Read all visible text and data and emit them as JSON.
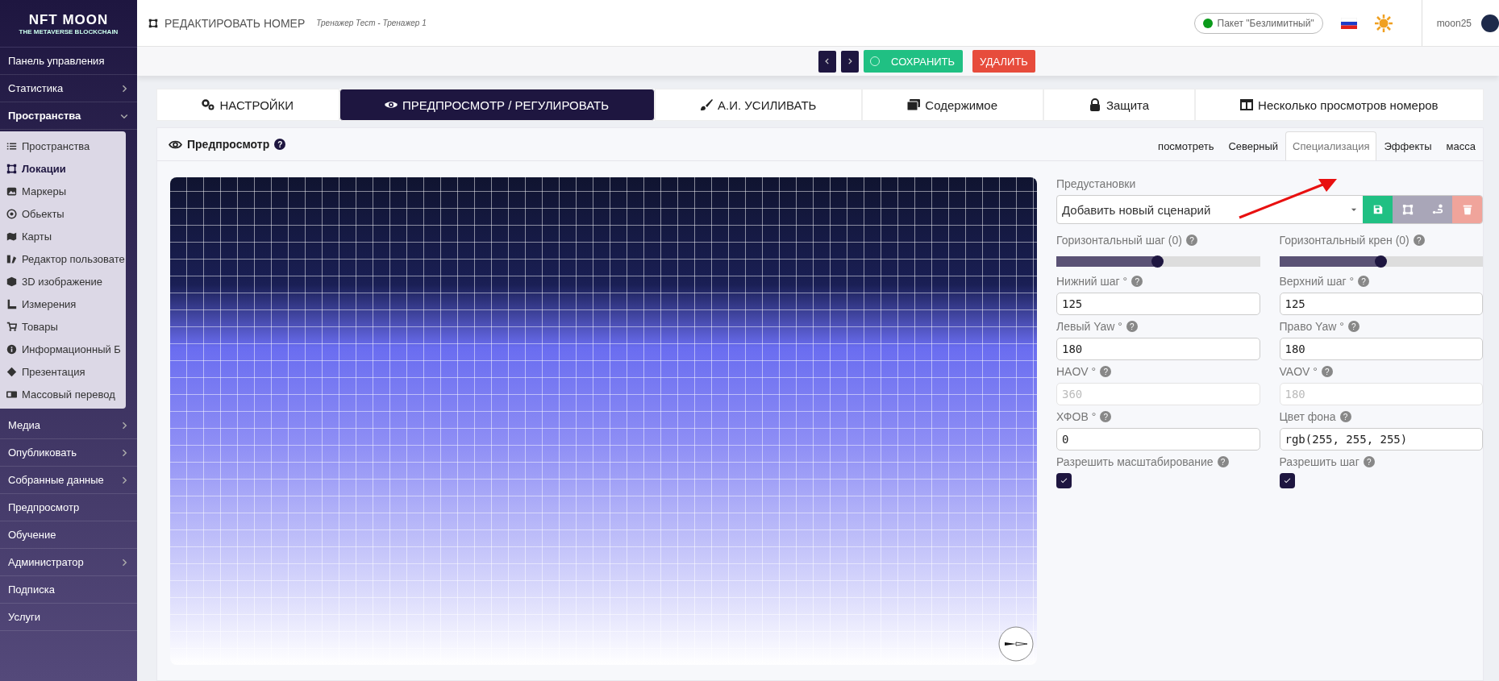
{
  "sidebar": {
    "logo": {
      "title": "NFT MOON",
      "subtitle": "THE METAVERSE BLOCKCHAIN"
    },
    "items": [
      {
        "label": "Панель управления",
        "kind": "link"
      },
      {
        "label": "Статистика",
        "kind": "group",
        "expanded": false
      },
      {
        "label": "Пространства",
        "kind": "group",
        "expanded": true,
        "children": [
          {
            "label": "Пространства",
            "selected": false
          },
          {
            "label": "Локации",
            "selected": true
          },
          {
            "label": "Маркеры",
            "selected": false
          },
          {
            "label": "Обьекты",
            "selected": false
          },
          {
            "label": "Карты",
            "selected": false
          },
          {
            "label": "Редактор пользовате",
            "selected": false
          },
          {
            "label": "3D изображение",
            "selected": false
          },
          {
            "label": "Измерения",
            "selected": false
          },
          {
            "label": "Товары",
            "selected": false
          },
          {
            "label": "Информационный Б",
            "selected": false
          },
          {
            "label": "Презентация",
            "selected": false
          },
          {
            "label": "Массовый перевод",
            "selected": false
          }
        ]
      },
      {
        "label": "Медиа",
        "kind": "group",
        "expanded": false
      },
      {
        "label": "Опубликовать",
        "kind": "group",
        "expanded": false
      },
      {
        "label": "Собранные данные",
        "kind": "group",
        "expanded": false
      },
      {
        "label": "Предпросмотр",
        "kind": "link"
      },
      {
        "label": "Обучение",
        "kind": "link"
      },
      {
        "label": "Администратор",
        "kind": "group",
        "expanded": false
      },
      {
        "label": "Подписка",
        "kind": "link"
      },
      {
        "label": "Услуги",
        "kind": "link"
      }
    ]
  },
  "header": {
    "title": "РЕДАКТИРОВАТЬ НОМЕР",
    "subtitle": "Тренажер Тест - Тренажер 1",
    "package": "Пакет \"Безлимитный\"",
    "user": "moon25"
  },
  "toolbar": {
    "save": "СОХРАНИТЬ",
    "delete": "УДАЛИТЬ"
  },
  "tabs": [
    {
      "label": "НАСТРОЙКИ",
      "selected": false
    },
    {
      "label": "ПРЕДПРОСМОТР / РЕГУЛИРОВАТЬ",
      "selected": true
    },
    {
      "label": "А.И. УСИЛИВАТЬ",
      "selected": false
    },
    {
      "label": "Содержимое",
      "selected": false
    },
    {
      "label": "Защита",
      "selected": false
    },
    {
      "label": "Несколько просмотров номеров",
      "selected": false
    }
  ],
  "panel": {
    "title": "Предпросмотр",
    "help": "?",
    "subtabs": [
      {
        "label": "посмотреть",
        "selected": false
      },
      {
        "label": "Северный",
        "selected": false
      },
      {
        "label": "Специализация",
        "selected": true
      },
      {
        "label": "Эффекты",
        "selected": false
      },
      {
        "label": "масса",
        "selected": false
      }
    ],
    "presets": {
      "label": "Предустановки",
      "value": "Добавить новый сценарий"
    },
    "sliders": [
      {
        "label": "Горизонтальный шаг (0)",
        "help": "?",
        "level": 0.5
      },
      {
        "label": "Горизонтальный крен (0)",
        "help": "?",
        "level": 0.5
      }
    ],
    "fields": [
      {
        "label": "Нижний шаг °",
        "help": "?",
        "value": "125",
        "disabled": false
      },
      {
        "label": "Верхний шаг °",
        "help": "?",
        "value": "125",
        "disabled": false
      },
      {
        "label": "Левый Yaw °",
        "help": "?",
        "value": "180",
        "disabled": false
      },
      {
        "label": "Право Yaw °",
        "help": "?",
        "value": "180",
        "disabled": false
      },
      {
        "label": "HAOV °",
        "help": "?",
        "value": "360",
        "disabled": true
      },
      {
        "label": "VAOV °",
        "help": "?",
        "value": "180",
        "disabled": true
      },
      {
        "label": "ХФОВ °",
        "help": "?",
        "value": "0",
        "disabled": false
      },
      {
        "label": "Цвет фона",
        "help": "?",
        "value": "rgb(255, 255, 255)",
        "disabled": false
      }
    ],
    "checkboxes": [
      {
        "label": "Разрешить масштабирование",
        "help": "?",
        "checked": true
      },
      {
        "label": "Разрешить шаг",
        "help": "?",
        "checked": true
      }
    ]
  }
}
